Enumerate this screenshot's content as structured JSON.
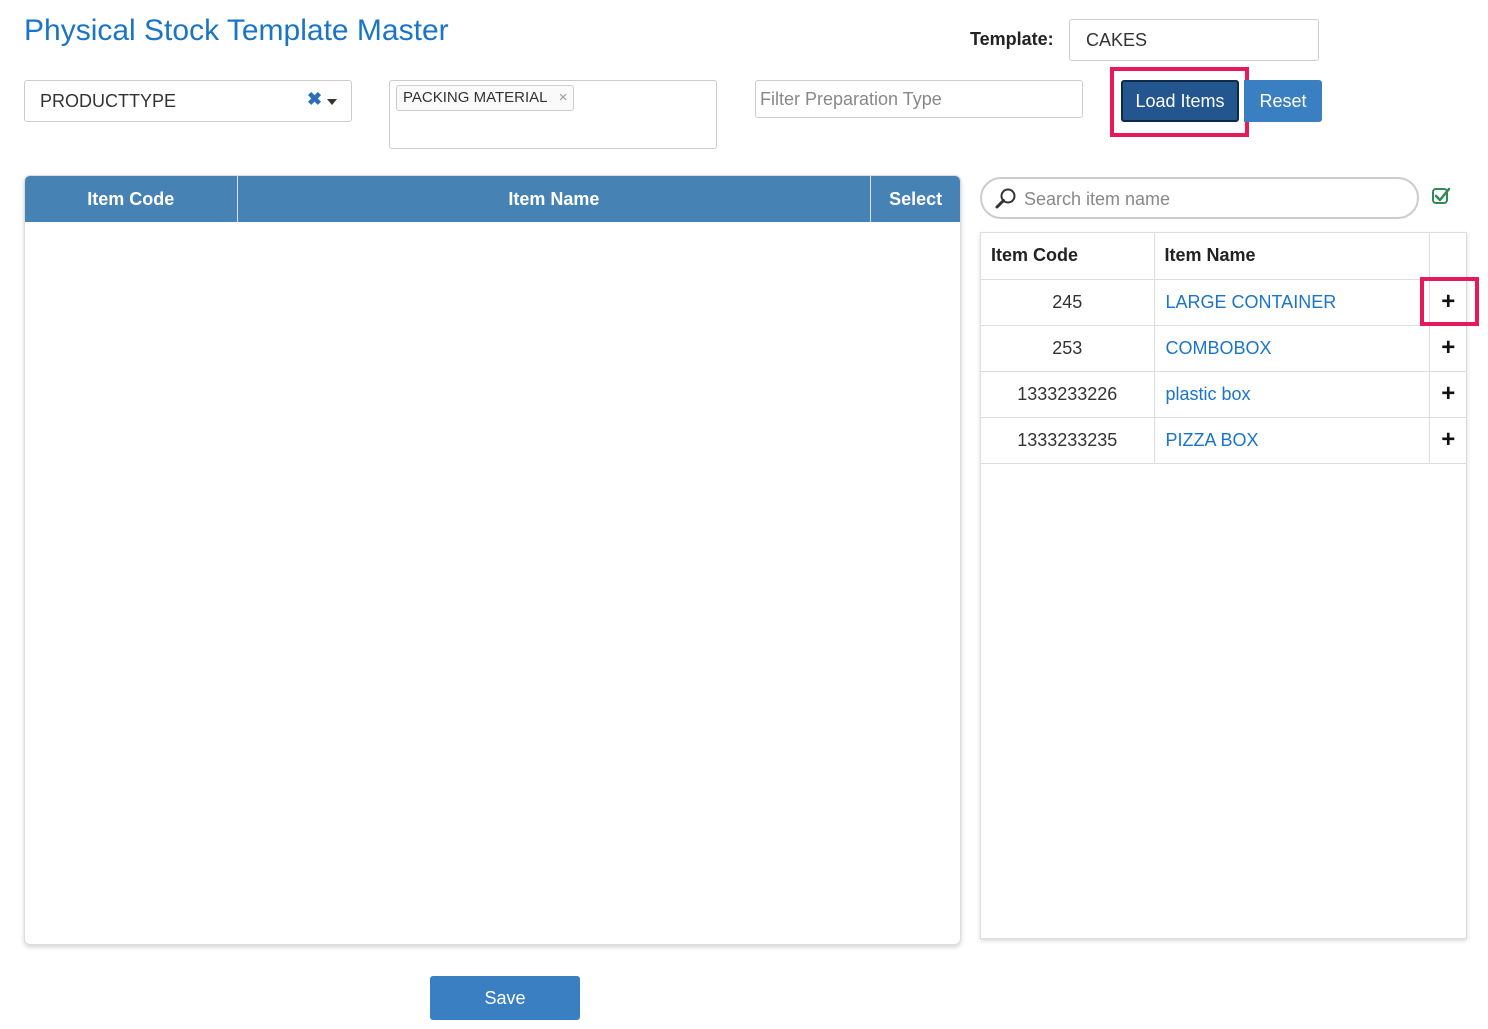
{
  "page": {
    "title": "Physical Stock Template Master"
  },
  "template": {
    "label": "Template:",
    "value": "CAKES"
  },
  "filters": {
    "product_type": {
      "value": "PRODUCTTYPE",
      "clear_icon": "close-icon",
      "caret_icon": "chevron-down-icon"
    },
    "category_tags": [
      {
        "label": "PACKING MATERIAL",
        "remove": "×"
      }
    ],
    "preparation": {
      "placeholder": "Filter Preparation Type",
      "value": ""
    }
  },
  "buttons": {
    "load": "Load Items",
    "reset": "Reset",
    "save": "Save"
  },
  "left_table": {
    "columns": [
      "Item Code",
      "Item Name",
      "Select"
    ],
    "rows": []
  },
  "search": {
    "placeholder": "Search item name",
    "icon": "search-icon",
    "select_all_icon": "checkbox-checked-icon"
  },
  "right_table": {
    "columns": [
      "Item Code",
      "Item Name",
      ""
    ],
    "rows": [
      {
        "code": "245",
        "name": "LARGE CONTAINER",
        "action": "+"
      },
      {
        "code": "253",
        "name": "COMBOBOX",
        "action": "+"
      },
      {
        "code": "1333233226",
        "name": "plastic box",
        "action": "+"
      },
      {
        "code": "1333233235",
        "name": "PIZZA BOX",
        "action": "+"
      }
    ]
  },
  "colors": {
    "title": "#1a75c9",
    "header_bg": "#4682b4",
    "primary_button": "#3a7fc1",
    "active_button": "#23558e",
    "highlight": "#e8195a",
    "link": "#1a75c9"
  }
}
